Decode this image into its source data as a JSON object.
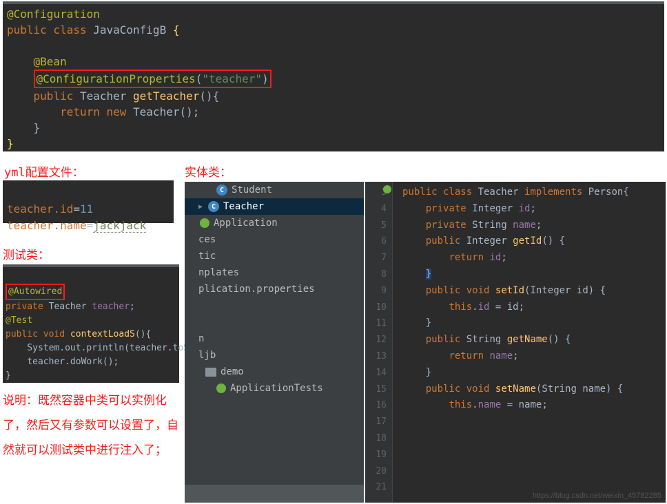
{
  "labels": {
    "yml": "yml配置文件：",
    "entity": "实体类：",
    "test": "测试类："
  },
  "top_editor": {
    "line1_ann": "@Configuration",
    "line2_kw": "public class ",
    "line2_cls": "JavaConfigB ",
    "line2_brace": "{",
    "line4_bean": "@Bean",
    "line5_ann": "@ConfigurationProperties",
    "line5_paren_open": "(",
    "line5_str": "\"teacher\"",
    "line5_paren_close": ")",
    "line6_kw": "public ",
    "line6_type": "Teacher ",
    "line6_mth": "getTeacher",
    "line6_tail": "(){",
    "line7_kw": "return new ",
    "line7_ctor": "Teacher",
    "line7_tail": "();",
    "line8_brace": "}",
    "line9_brace": "}"
  },
  "yml_panel": {
    "l1_key": "teacher.id",
    "l1_val": "11",
    "l2_key": "teacher.name",
    "l2_val": "jackjack"
  },
  "test_panel": {
    "l1_ann": "@Autowired",
    "l2_kw": "private ",
    "l2_type": "Teacher ",
    "l2_var": "teacher",
    "l2_semi": ";",
    "l3_ann": "@Test",
    "l4_kw": "public void ",
    "l4_mth": "contextLoadS",
    "l4_tail": "(){",
    "l5": "    System.out.println(teacher.toString());",
    "l6": "    teacher.doWork();",
    "l7": "}"
  },
  "note": "说明：既然容器中类可以实例化了，然后又有参数可以设置了，自然就可以测试类中进行注入了；",
  "tree": {
    "items": [
      {
        "icon": "c",
        "label": "Student",
        "indent": 26,
        "arrow": "",
        "sel": false
      },
      {
        "icon": "c",
        "label": "Teacher",
        "indent": 14,
        "arrow": "▶",
        "sel": true
      },
      {
        "icon": "boot",
        "label": "Application",
        "indent": 2,
        "arrow": "",
        "sel": false
      },
      {
        "icon": "",
        "label": "ces",
        "indent": 0,
        "arrow": "",
        "sel": false,
        "cut": true
      },
      {
        "icon": "",
        "label": "tic",
        "indent": 0,
        "arrow": "",
        "sel": false,
        "cut": true
      },
      {
        "icon": "",
        "label": "nplates",
        "indent": 0,
        "arrow": "",
        "sel": false,
        "cut": true
      },
      {
        "icon": "",
        "label": "plication.properties",
        "indent": 0,
        "arrow": "",
        "sel": false,
        "cut": true
      },
      {
        "icon": "",
        "label": "",
        "indent": 0,
        "arrow": "",
        "sel": false,
        "spacer": true
      },
      {
        "icon": "",
        "label": "",
        "indent": 0,
        "arrow": "",
        "sel": false,
        "spacer": true
      },
      {
        "icon": "",
        "label": "n",
        "indent": 0,
        "arrow": "",
        "sel": false,
        "cut": true
      },
      {
        "icon": "",
        "label": "ljb",
        "indent": 0,
        "arrow": "",
        "sel": false,
        "cut": true
      },
      {
        "icon": "folder",
        "label": "demo",
        "indent": 10,
        "arrow": "",
        "sel": false
      },
      {
        "icon": "boot",
        "label": "ApplicationTests",
        "indent": 26,
        "arrow": "",
        "sel": false
      }
    ]
  },
  "right_editor": {
    "line_start": 3,
    "gutter_lines": [
      "3",
      "4",
      "5",
      "6",
      "7",
      "8",
      "9",
      "10",
      "11",
      "12",
      "13",
      "14",
      "15",
      "16",
      "17",
      "18",
      "19",
      "20",
      "21"
    ],
    "lines": [
      {
        "c": "public class Teacher implements Person{",
        "t": "sig"
      },
      {
        "c": "",
        "t": "p"
      },
      {
        "c": "    private Integer id;",
        "t": "p"
      },
      {
        "c": "    private String name;",
        "t": "p"
      },
      {
        "c": "",
        "t": "p"
      },
      {
        "c": "    public Integer getId() {",
        "t": "mth",
        "m": "getId"
      },
      {
        "c": "        return id;",
        "t": "ret",
        "f": "id"
      },
      {
        "c": "    }",
        "t": "close",
        "sel": true
      },
      {
        "c": "",
        "t": "p"
      },
      {
        "c": "    public void setId(Integer id) {",
        "t": "mth",
        "m": "setId"
      },
      {
        "c": "        this.id = id;",
        "t": "set",
        "f": "id"
      },
      {
        "c": "    }",
        "t": "close"
      },
      {
        "c": "",
        "t": "p"
      },
      {
        "c": "    public String getName() {",
        "t": "mth",
        "m": "getName"
      },
      {
        "c": "        return name;",
        "t": "ret",
        "f": "name"
      },
      {
        "c": "    }",
        "t": "close"
      },
      {
        "c": "",
        "t": "p"
      },
      {
        "c": "    public void setName(String name) {",
        "t": "mth",
        "m": "setName"
      },
      {
        "c": "        this.name = name;",
        "t": "set",
        "f": "name"
      }
    ]
  },
  "watermark": "https://blog.csdn.net/weixin_45782285"
}
